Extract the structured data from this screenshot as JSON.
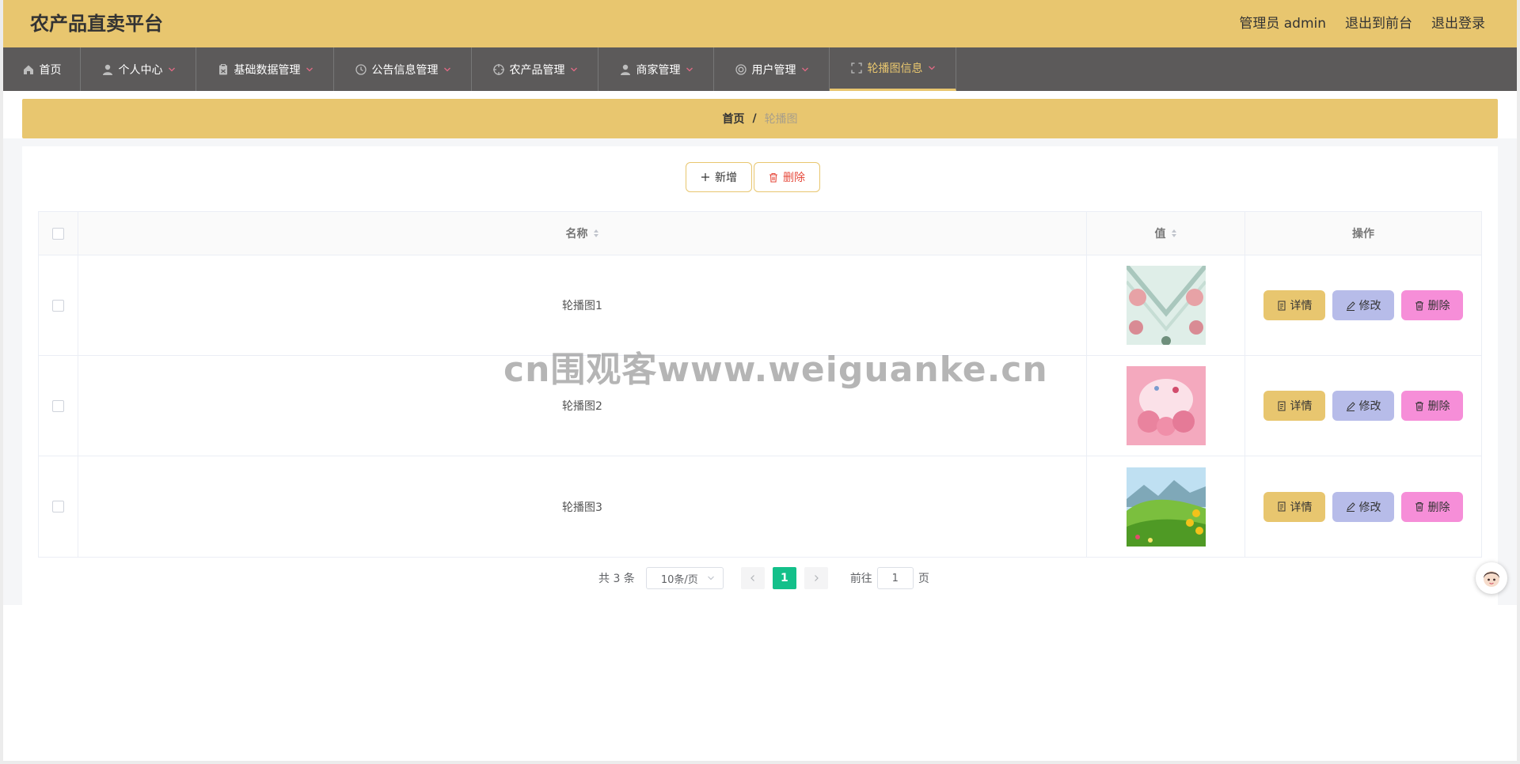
{
  "header": {
    "title": "农产品直卖平台",
    "admin_label": "管理员 admin",
    "to_front": "退出到前台",
    "logout": "退出登录"
  },
  "nav": [
    {
      "label": "首页",
      "icon": "home-icon"
    },
    {
      "label": "个人中心",
      "icon": "user-icon"
    },
    {
      "label": "基础数据管理",
      "icon": "clipboard-icon"
    },
    {
      "label": "公告信息管理",
      "icon": "clock-icon"
    },
    {
      "label": "农产品管理",
      "icon": "target-icon"
    },
    {
      "label": "商家管理",
      "icon": "user-icon"
    },
    {
      "label": "用户管理",
      "icon": "lifebuoy-icon"
    },
    {
      "label": "轮播图信息",
      "icon": "fullscreen-icon",
      "active": true
    }
  ],
  "breadcrumb": {
    "home": "首页",
    "sep": "/",
    "current": "轮播图"
  },
  "toolbar": {
    "add_label": "新增",
    "delete_label": "删除"
  },
  "table": {
    "headers": {
      "name": "名称",
      "value": "值",
      "ops": "操作"
    },
    "rows": [
      {
        "name": "轮播图1",
        "image": "floral-pattern-image"
      },
      {
        "name": "轮播图2",
        "image": "pink-roses-image"
      },
      {
        "name": "轮播图3",
        "image": "green-meadow-image"
      }
    ],
    "ops": {
      "detail": "详情",
      "edit": "修改",
      "delete": "删除"
    }
  },
  "pagination": {
    "total": "共 3 条",
    "page_size": "10条/页",
    "current_page": "1",
    "goto_label": "前往",
    "goto_value": "1",
    "page_label": "页"
  },
  "watermark": "cn围观客www.weiguanke.cn",
  "colors": {
    "header": "#e8c66f",
    "nav": "#5c5a5a",
    "active": "#e8c66f",
    "edit": "#b7bce9",
    "delete": "#f68ed8",
    "pager": "#13c08a"
  }
}
